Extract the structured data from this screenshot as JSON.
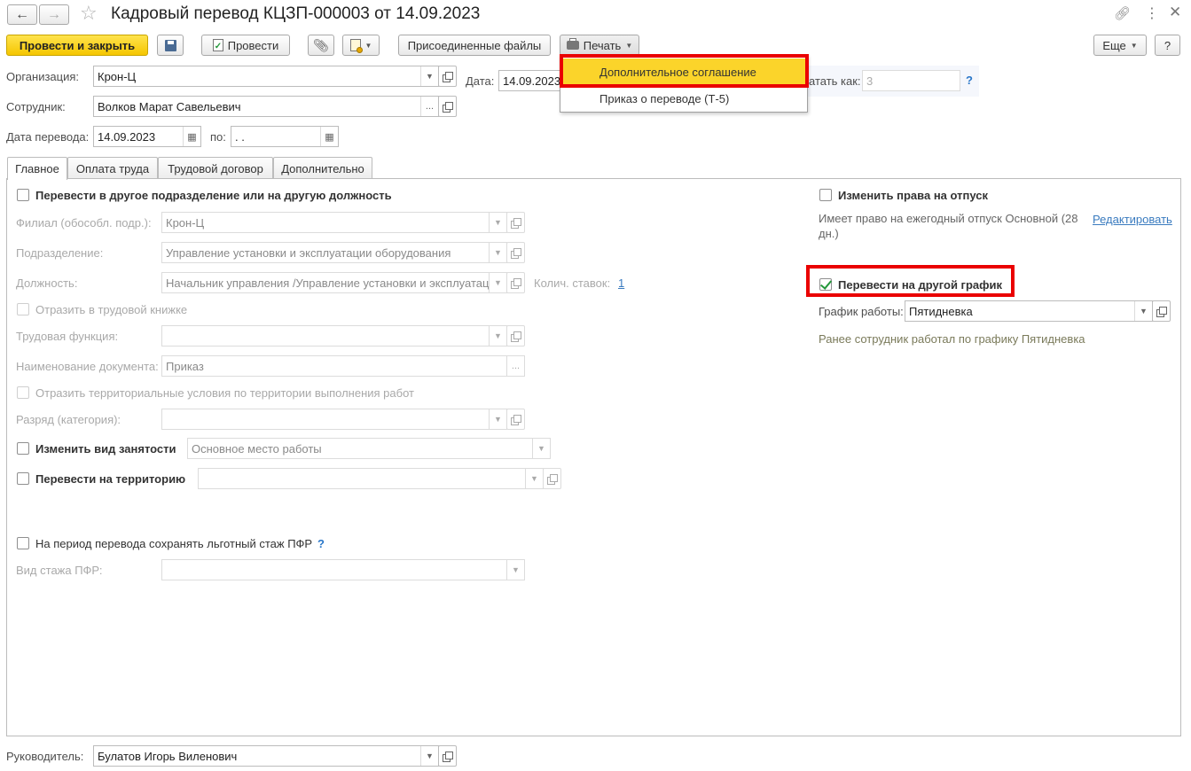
{
  "window": {
    "title": "Кадровый перевод КЦЗП-000003 от 14.09.2023"
  },
  "toolbar": {
    "post_close": "Провести и закрыть",
    "post": "Провести",
    "attached_files": "Присоединенные файлы",
    "print": "Печать",
    "more": "Еще",
    "help": "?"
  },
  "print_menu": {
    "items": [
      "Дополнительное соглашение",
      "Приказ о переводе (Т-5)"
    ]
  },
  "header": {
    "org_label": "Организация:",
    "org_value": "Крон-Ц",
    "date_label": "Дата:",
    "date_value": "14.09.2023",
    "print_as_label": "атать как:",
    "print_as_value": "3",
    "employee_label": "Сотрудник:",
    "employee_value": "Волков Марат Савельевич",
    "transfer_date_label": "Дата перевода:",
    "transfer_date_value": "14.09.2023",
    "to_label": "по:",
    "to_value": " .  ."
  },
  "tabs": [
    "Главное",
    "Оплата труда",
    "Трудовой договор",
    "Дополнительно"
  ],
  "main": {
    "transfer_dept_label": "Перевести в другое подразделение или на другую должность",
    "branch_label": "Филиал (обособл. подр.):",
    "branch_value": "Крон-Ц",
    "dept_label": "Подразделение:",
    "dept_value": "Управление установки и эксплуатации оборудования",
    "position_label": "Должность:",
    "position_value": "Начальник управления /Управление установки и эксплуатац",
    "rates_label": "Колич. ставок:",
    "rates_value": "1",
    "reflect_book_label": "Отразить в трудовой книжке",
    "labor_function_label": "Трудовая функция:",
    "doc_name_label": "Наименование документа:",
    "doc_name_value": "Приказ",
    "territorial_label": "Отразить территориальные условия по территории выполнения работ",
    "grade_label": "Разряд (категория):",
    "employment_type_label": "Изменить вид занятости",
    "employment_type_value": "Основное место работы",
    "territory_label": "Перевести на территорию",
    "pfr_keep_label": "На период перевода сохранять льготный стаж ПФР",
    "pfr_type_label": "Вид стажа ПФР:"
  },
  "right": {
    "vacation_label": "Изменить права на отпуск",
    "vacation_info": "Имеет право на ежегодный отпуск Основной (28 дн.)",
    "edit_link": "Редактировать",
    "schedule_label": "Перевести на другой график",
    "work_schedule_label": "График работы:",
    "work_schedule_value": "Пятидневка",
    "prev_schedule_note": "Ранее сотрудник работал по графику Пятидневка"
  },
  "footer": {
    "manager_label": "Руководитель:",
    "manager_value": "Булатов Игорь Виленович"
  },
  "colors": {
    "accent_yellow": "#f5c600",
    "highlight_red": "#ea0000",
    "link_blue": "#3a7bbf",
    "check_green": "#23973a"
  }
}
